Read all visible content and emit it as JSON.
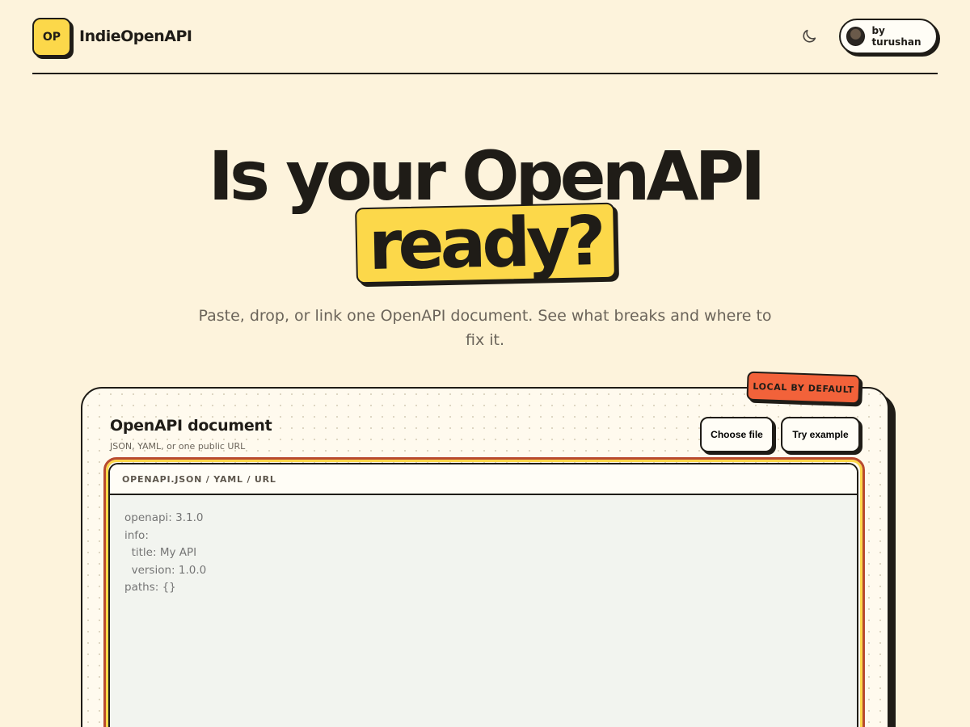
{
  "header": {
    "logo_text": "OP",
    "brand": "IndieOpenAPI",
    "theme_icon": "moon-icon",
    "author_label": "by turushan"
  },
  "hero": {
    "line1": "Is your OpenAPI",
    "highlight": "ready?",
    "subtitle": "Paste, drop, or link one OpenAPI document. See what breaks and where to fix it."
  },
  "card": {
    "badge": "LOCAL BY DEFAULT",
    "title": "OpenAPI document",
    "hint": "JSON, YAML, or one public URL",
    "choose_file_label": "Choose file",
    "try_example_label": "Try example",
    "editor_label": "OPENAPI.JSON / YAML / URL",
    "editor_placeholder": "openapi: 3.1.0\ninfo:\n  title: My API\n  version: 1.0.0\npaths: {}"
  },
  "colors": {
    "background": "#fdf3dc",
    "accent_yellow": "#fcd84a",
    "accent_orange": "#f2623a",
    "ink": "#1f1c17"
  }
}
